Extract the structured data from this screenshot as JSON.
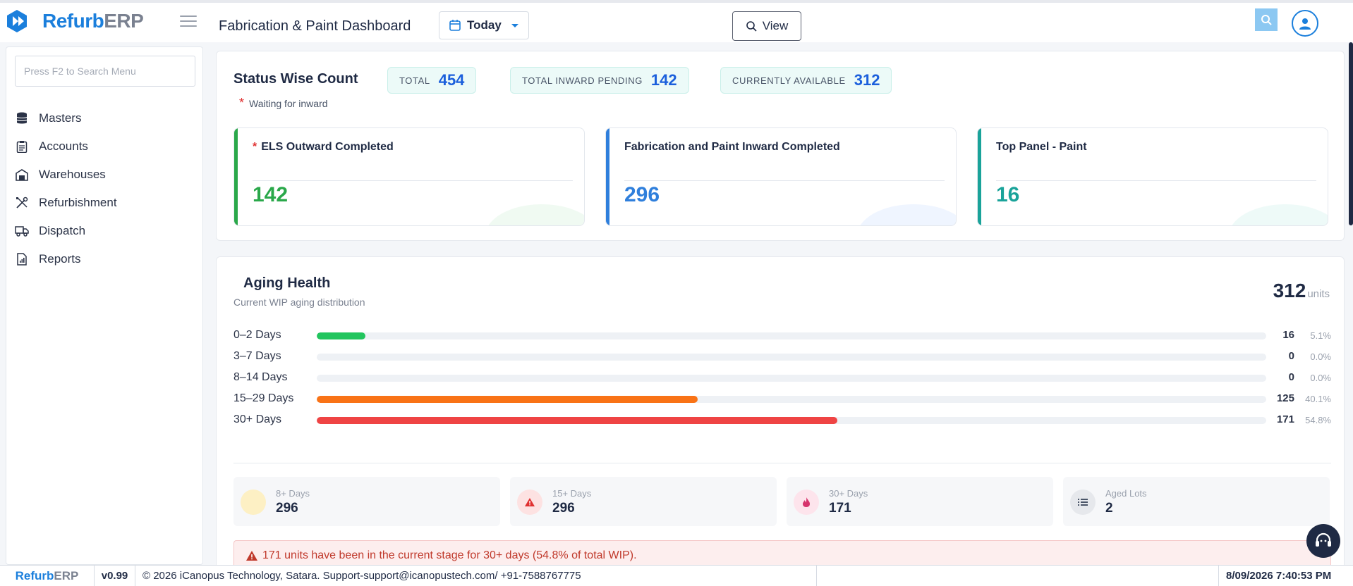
{
  "header": {
    "brand_a": "Refurb",
    "brand_b": "ERP",
    "page_title": "Fabrication & Paint Dashboard",
    "date_filter": "Today",
    "view_label": "View"
  },
  "sidebar": {
    "search_placeholder": "Press F2 to Search Menu",
    "items": [
      {
        "label": "Masters",
        "icon": "database-icon"
      },
      {
        "label": "Accounts",
        "icon": "clipboard-icon"
      },
      {
        "label": "Warehouses",
        "icon": "warehouse-icon"
      },
      {
        "label": "Refurbishment",
        "icon": "tools-icon"
      },
      {
        "label": "Dispatch",
        "icon": "truck-icon"
      },
      {
        "label": "Reports",
        "icon": "report-icon"
      }
    ]
  },
  "status": {
    "title": "Status Wise Count",
    "pills": [
      {
        "label": "TOTAL",
        "value": "454"
      },
      {
        "label": "TOTAL INWARD PENDING",
        "value": "142"
      },
      {
        "label": "CURRENTLY AVAILABLE",
        "value": "312"
      }
    ],
    "waiting_note": "Waiting for inward",
    "cards": [
      {
        "title": "ELS Outward Completed",
        "value": "142",
        "starred": true,
        "color": "#2aa84a"
      },
      {
        "title": "Fabrication and Paint Inward Completed",
        "value": "296",
        "starred": false,
        "color": "#2f7fdc"
      },
      {
        "title": "Top Panel - Paint",
        "value": "16",
        "starred": false,
        "color": "#1aa39a"
      }
    ]
  },
  "aging": {
    "title": "Aging Health",
    "subtitle": "Current WIP aging distribution",
    "total": "312",
    "total_unit": "units",
    "rows": [
      {
        "label": "0–2 Days",
        "count": "16",
        "pct": "5.1%",
        "fraction": 0.051,
        "color": "#22c55e"
      },
      {
        "label": "3–7 Days",
        "count": "0",
        "pct": "0.0%",
        "fraction": 0.0,
        "color": "#22c55e"
      },
      {
        "label": "8–14 Days",
        "count": "0",
        "pct": "0.0%",
        "fraction": 0.0,
        "color": "#22c55e"
      },
      {
        "label": "15–29 Days",
        "count": "125",
        "pct": "40.1%",
        "fraction": 0.401,
        "color": "#f97316"
      },
      {
        "label": "30+ Days",
        "count": "171",
        "pct": "54.8%",
        "fraction": 0.548,
        "color": "#ef4444"
      }
    ],
    "summary": [
      {
        "label": "8+ Days",
        "value": "296",
        "icon": "circle-icon"
      },
      {
        "label": "15+ Days",
        "value": "296",
        "icon": "warning-icon"
      },
      {
        "label": "30+ Days",
        "value": "171",
        "icon": "fire-icon"
      },
      {
        "label": "Aged Lots",
        "value": "2",
        "icon": "list-icon"
      }
    ],
    "alert": "171 units have been in the current stage for 30+ days (54.8% of total WIP)."
  },
  "footer": {
    "brand_a": "Refurb",
    "brand_b": "ERP",
    "version": "v0.99",
    "copyright_pre": "© 2026 iCanopus Technology, Satara. Support-",
    "support_email": "support@icanopustech.com",
    "phone": " / +91-7588767775",
    "datetime": "8/09/2026 7:40:53 PM"
  }
}
